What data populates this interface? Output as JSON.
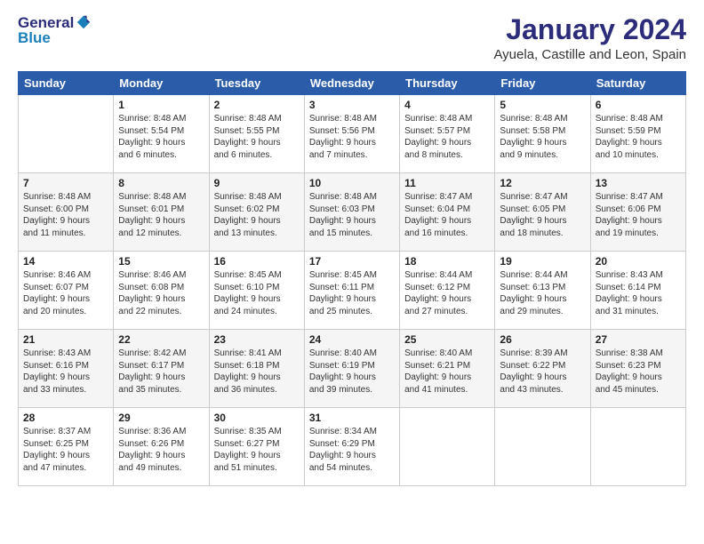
{
  "header": {
    "logo_general": "General",
    "logo_blue": "Blue",
    "main_title": "January 2024",
    "subtitle": "Ayuela, Castille and Leon, Spain"
  },
  "calendar": {
    "columns": [
      "Sunday",
      "Monday",
      "Tuesday",
      "Wednesday",
      "Thursday",
      "Friday",
      "Saturday"
    ],
    "rows": [
      [
        {
          "day": "",
          "info": ""
        },
        {
          "day": "1",
          "info": "Sunrise: 8:48 AM\nSunset: 5:54 PM\nDaylight: 9 hours\nand 6 minutes."
        },
        {
          "day": "2",
          "info": "Sunrise: 8:48 AM\nSunset: 5:55 PM\nDaylight: 9 hours\nand 6 minutes."
        },
        {
          "day": "3",
          "info": "Sunrise: 8:48 AM\nSunset: 5:56 PM\nDaylight: 9 hours\nand 7 minutes."
        },
        {
          "day": "4",
          "info": "Sunrise: 8:48 AM\nSunset: 5:57 PM\nDaylight: 9 hours\nand 8 minutes."
        },
        {
          "day": "5",
          "info": "Sunrise: 8:48 AM\nSunset: 5:58 PM\nDaylight: 9 hours\nand 9 minutes."
        },
        {
          "day": "6",
          "info": "Sunrise: 8:48 AM\nSunset: 5:59 PM\nDaylight: 9 hours\nand 10 minutes."
        }
      ],
      [
        {
          "day": "7",
          "info": "Sunrise: 8:48 AM\nSunset: 6:00 PM\nDaylight: 9 hours\nand 11 minutes."
        },
        {
          "day": "8",
          "info": "Sunrise: 8:48 AM\nSunset: 6:01 PM\nDaylight: 9 hours\nand 12 minutes."
        },
        {
          "day": "9",
          "info": "Sunrise: 8:48 AM\nSunset: 6:02 PM\nDaylight: 9 hours\nand 13 minutes."
        },
        {
          "day": "10",
          "info": "Sunrise: 8:48 AM\nSunset: 6:03 PM\nDaylight: 9 hours\nand 15 minutes."
        },
        {
          "day": "11",
          "info": "Sunrise: 8:47 AM\nSunset: 6:04 PM\nDaylight: 9 hours\nand 16 minutes."
        },
        {
          "day": "12",
          "info": "Sunrise: 8:47 AM\nSunset: 6:05 PM\nDaylight: 9 hours\nand 18 minutes."
        },
        {
          "day": "13",
          "info": "Sunrise: 8:47 AM\nSunset: 6:06 PM\nDaylight: 9 hours\nand 19 minutes."
        }
      ],
      [
        {
          "day": "14",
          "info": "Sunrise: 8:46 AM\nSunset: 6:07 PM\nDaylight: 9 hours\nand 20 minutes."
        },
        {
          "day": "15",
          "info": "Sunrise: 8:46 AM\nSunset: 6:08 PM\nDaylight: 9 hours\nand 22 minutes."
        },
        {
          "day": "16",
          "info": "Sunrise: 8:45 AM\nSunset: 6:10 PM\nDaylight: 9 hours\nand 24 minutes."
        },
        {
          "day": "17",
          "info": "Sunrise: 8:45 AM\nSunset: 6:11 PM\nDaylight: 9 hours\nand 25 minutes."
        },
        {
          "day": "18",
          "info": "Sunrise: 8:44 AM\nSunset: 6:12 PM\nDaylight: 9 hours\nand 27 minutes."
        },
        {
          "day": "19",
          "info": "Sunrise: 8:44 AM\nSunset: 6:13 PM\nDaylight: 9 hours\nand 29 minutes."
        },
        {
          "day": "20",
          "info": "Sunrise: 8:43 AM\nSunset: 6:14 PM\nDaylight: 9 hours\nand 31 minutes."
        }
      ],
      [
        {
          "day": "21",
          "info": "Sunrise: 8:43 AM\nSunset: 6:16 PM\nDaylight: 9 hours\nand 33 minutes."
        },
        {
          "day": "22",
          "info": "Sunrise: 8:42 AM\nSunset: 6:17 PM\nDaylight: 9 hours\nand 35 minutes."
        },
        {
          "day": "23",
          "info": "Sunrise: 8:41 AM\nSunset: 6:18 PM\nDaylight: 9 hours\nand 36 minutes."
        },
        {
          "day": "24",
          "info": "Sunrise: 8:40 AM\nSunset: 6:19 PM\nDaylight: 9 hours\nand 39 minutes."
        },
        {
          "day": "25",
          "info": "Sunrise: 8:40 AM\nSunset: 6:21 PM\nDaylight: 9 hours\nand 41 minutes."
        },
        {
          "day": "26",
          "info": "Sunrise: 8:39 AM\nSunset: 6:22 PM\nDaylight: 9 hours\nand 43 minutes."
        },
        {
          "day": "27",
          "info": "Sunrise: 8:38 AM\nSunset: 6:23 PM\nDaylight: 9 hours\nand 45 minutes."
        }
      ],
      [
        {
          "day": "28",
          "info": "Sunrise: 8:37 AM\nSunset: 6:25 PM\nDaylight: 9 hours\nand 47 minutes."
        },
        {
          "day": "29",
          "info": "Sunrise: 8:36 AM\nSunset: 6:26 PM\nDaylight: 9 hours\nand 49 minutes."
        },
        {
          "day": "30",
          "info": "Sunrise: 8:35 AM\nSunset: 6:27 PM\nDaylight: 9 hours\nand 51 minutes."
        },
        {
          "day": "31",
          "info": "Sunrise: 8:34 AM\nSunset: 6:29 PM\nDaylight: 9 hours\nand 54 minutes."
        },
        {
          "day": "",
          "info": ""
        },
        {
          "day": "",
          "info": ""
        },
        {
          "day": "",
          "info": ""
        }
      ]
    ]
  }
}
